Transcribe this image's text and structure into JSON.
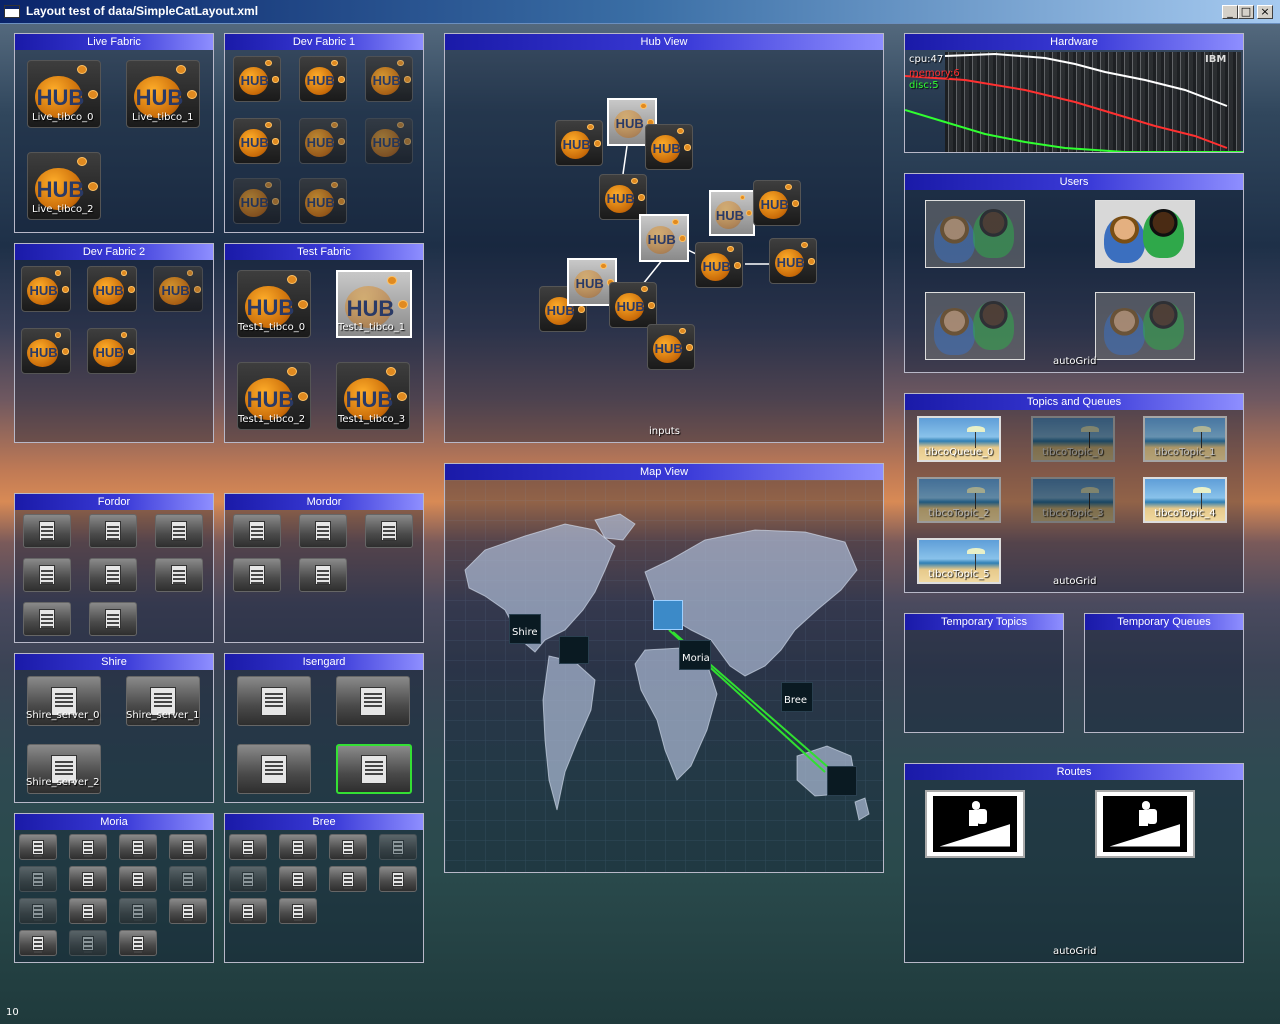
{
  "window": {
    "title": "Layout test of data/SimpleCatLayout.xml",
    "min_label": "_",
    "max_label": "□",
    "close_label": "×"
  },
  "panels": {
    "live_fabric": "Live Fabric",
    "dev_fabric_1": "Dev Fabric 1",
    "hub_view": "Hub View",
    "hardware": "Hardware",
    "dev_fabric_2": "Dev Fabric 2",
    "test_fabric": "Test Fabric",
    "users": "Users",
    "topics_queues": "Topics and Queues",
    "map_view": "Map View",
    "fordor": "Fordor",
    "mordor": "Mordor",
    "shire": "Shire",
    "isengard": "Isengard",
    "temporary_topics": "Temporary Topics",
    "temporary_queues": "Temporary Queues",
    "moria": "Moria",
    "bree": "Bree",
    "routes": "Routes"
  },
  "hub_text": "HUB",
  "live_fabric_items": [
    "Live_tibco_0",
    "Live_tibco_1",
    "Live_tibco_2"
  ],
  "test_fabric_items": [
    "Test1_tibco_0",
    "Test1_tibco_1",
    "Test1_tibco_2",
    "Test1_tibco_3"
  ],
  "hub_view": {
    "footer": "inputs"
  },
  "hardware": {
    "cpu": "cpu:47",
    "memory": "memory:6",
    "disc": "disc:5",
    "brand": "IBM",
    "colors": {
      "cpu": "#ffffff",
      "memory": "#ff3030",
      "disc": "#30ff30"
    }
  },
  "users": {
    "footer": "autoGrid"
  },
  "topics_queues": {
    "items": [
      "tibcoQueue_0",
      "tibcoTopic_0",
      "tibcoTopic_1",
      "tibcoTopic_2",
      "tibcoTopic_3",
      "tibcoTopic_4",
      "tibcoTopic_5"
    ],
    "footer": "autoGrid"
  },
  "map_view": {
    "nodes": [
      "Shire",
      "Moria",
      "Bree"
    ],
    "route_color": "#30e030"
  },
  "shire_items": [
    "Shire_server_0",
    "Shire_server_1",
    "Shire_server_2"
  ],
  "routes": {
    "footer": "autoGrid"
  },
  "fps": "10",
  "icons": [
    "hub-icon",
    "server-icon",
    "users-icon",
    "beach-icon",
    "hiker-icon",
    "world-map"
  ]
}
